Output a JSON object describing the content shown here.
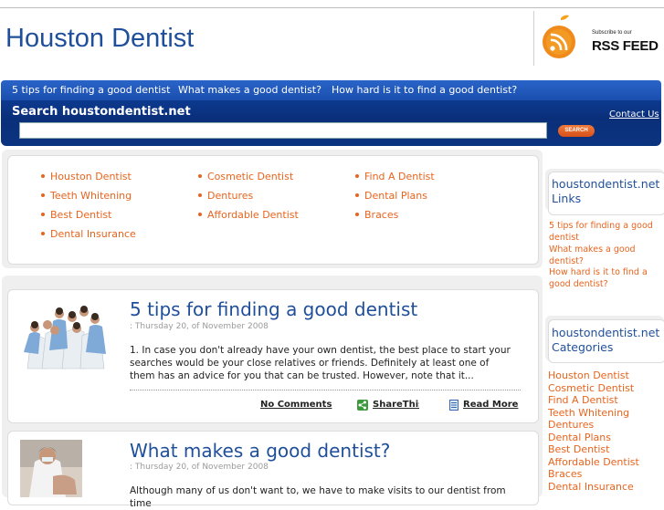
{
  "header": {
    "site_title": "Houston Dentist",
    "rss_subscribe": "Subscribe to our",
    "rss_feed": "RSS FEED"
  },
  "nav": {
    "items": [
      {
        "label": "5 tips for finding a good dentist"
      },
      {
        "label": "What makes a good dentist?"
      },
      {
        "label": "How hard is it to find a good dentist?"
      }
    ]
  },
  "search": {
    "label": "Search houstondentist.net",
    "contact_label": "Contact Us",
    "button_label": "SEARCH",
    "placeholder": ""
  },
  "links": {
    "col1": [
      "Houston Dentist",
      "Teeth Whitening",
      "Best Dentist",
      "Dental Insurance"
    ],
    "col2": [
      "Cosmetic Dentist",
      "Dentures",
      "Affordable Dentist"
    ],
    "col3": [
      "Find A Dentist",
      "Dental Plans",
      "Braces"
    ]
  },
  "posts": [
    {
      "title": "5 tips for finding a good dentist",
      "date": ": Thursday 20, of November 2008",
      "excerpt": "1. In case you don't already have your own dentist, the best place to start your searches would be your close relatives or friends. Definitely at least one of them has an advice for you that can be trusted. However, note that it...",
      "comments_label": "No Comments",
      "share_label": "ShareThis",
      "readmore_label": "Read More"
    },
    {
      "title": "What makes a good dentist?",
      "date": ": Thursday 20, of November 2008",
      "excerpt": "Although many of us don't want to, we have to make visits to our dentist from time"
    }
  ],
  "sidebar": {
    "links_heading_1": "houstondentist.net",
    "links_heading_2": "Links",
    "links": [
      "5 tips for finding a good dentist",
      "What makes a good dentist?",
      "How hard is it to find a good dentist?"
    ],
    "categories_heading_1": "houstondentist.net",
    "categories_heading_2": "Categories",
    "categories": [
      "Houston Dentist",
      "Cosmetic Dentist",
      "Find A Dentist",
      "Teeth Whitening",
      "Dentures",
      "Dental Plans",
      "Best Dentist",
      "Affordable Dentist",
      "Braces",
      "Dental Insurance"
    ]
  },
  "colors": {
    "title_blue": "#1f4f9a",
    "nav_blue": "#1a4fae",
    "link_orange": "#e8641e"
  }
}
